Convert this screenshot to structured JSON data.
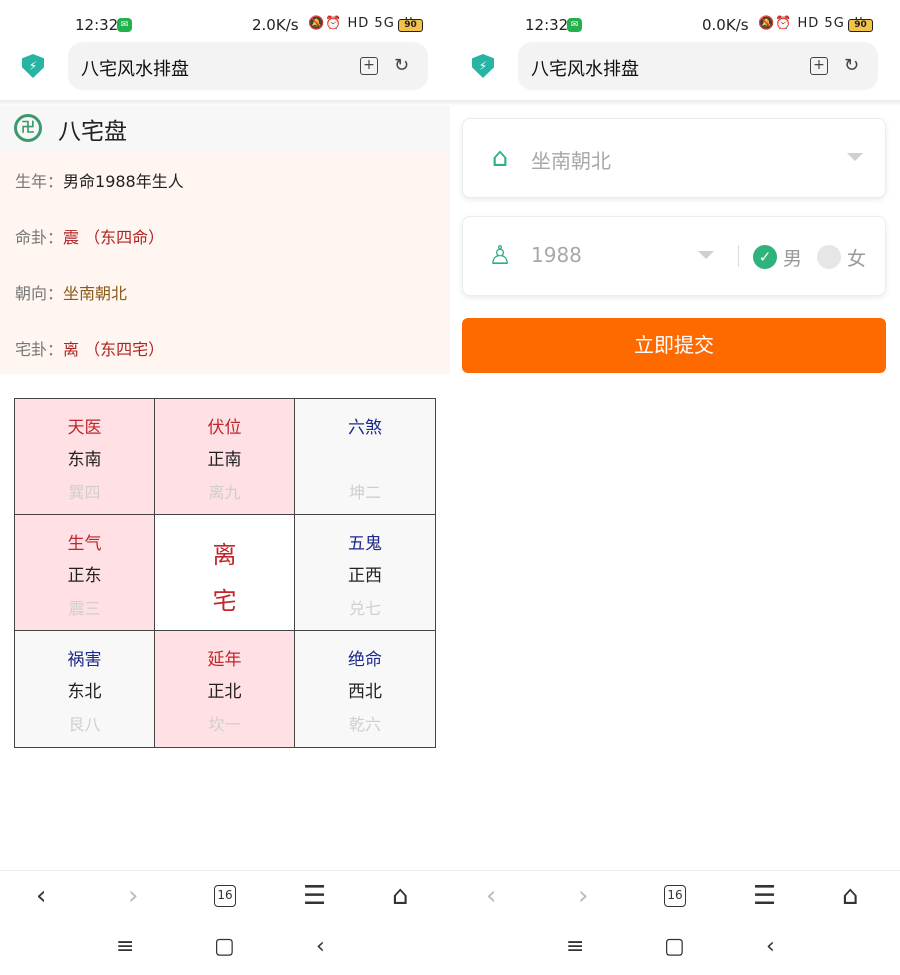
{
  "left": {
    "status": {
      "time": "12:32",
      "speed": "2.0K/s",
      "icons": "🔕⏰ HD 5G ıll",
      "battery": "90"
    },
    "address": {
      "title": "八宅风水排盘"
    },
    "pan_title": "八宅盘",
    "info": [
      {
        "label": "生年：",
        "value": "男命1988年生人",
        "tone": "dark"
      },
      {
        "label": "命卦：",
        "value": "震 （东四命）",
        "tone": "red"
      },
      {
        "label": "朝向：",
        "value": "坐南朝北",
        "tone": "dark"
      },
      {
        "label": "宅卦：",
        "value": "离 （东四宅）",
        "tone": "red"
      }
    ],
    "grid": [
      {
        "star": "天医",
        "dir": "东南",
        "gua": "巽四",
        "kind": "good"
      },
      {
        "star": "伏位",
        "dir": "正南",
        "gua": "离九",
        "kind": "good"
      },
      {
        "star": "六煞",
        "dir": "",
        "gua": "坤二",
        "kind": "bad"
      },
      {
        "star": "生气",
        "dir": "正东",
        "gua": "震三",
        "kind": "good"
      },
      {
        "center": [
          "离",
          "宅"
        ]
      },
      {
        "star": "五鬼",
        "dir": "正西",
        "gua": "兑七",
        "kind": "bad"
      },
      {
        "star": "祸害",
        "dir": "东北",
        "gua": "艮八",
        "kind": "bad"
      },
      {
        "star": "延年",
        "dir": "正北",
        "gua": "坎一",
        "kind": "good"
      },
      {
        "star": "绝命",
        "dir": "西北",
        "gua": "乾六",
        "kind": "bad"
      }
    ],
    "nav": {
      "tabs": "16"
    }
  },
  "right": {
    "status": {
      "time": "12:32",
      "speed": "0.0K/s",
      "icons": "🔕⏰ HD 5G ıll",
      "battery": "90"
    },
    "address": {
      "title": "八宅风水排盘"
    },
    "orientation": {
      "value": "坐南朝北"
    },
    "birth": {
      "year": "1988",
      "male": "男",
      "female": "女"
    },
    "submit": "立即提交",
    "nav": {
      "tabs": "16"
    }
  },
  "colors": {
    "accent": "#2fb27c",
    "submit": "#ff6a00",
    "good": "#c0262a",
    "bad": "#1b2a8a",
    "pink": "#ffe0e4"
  }
}
